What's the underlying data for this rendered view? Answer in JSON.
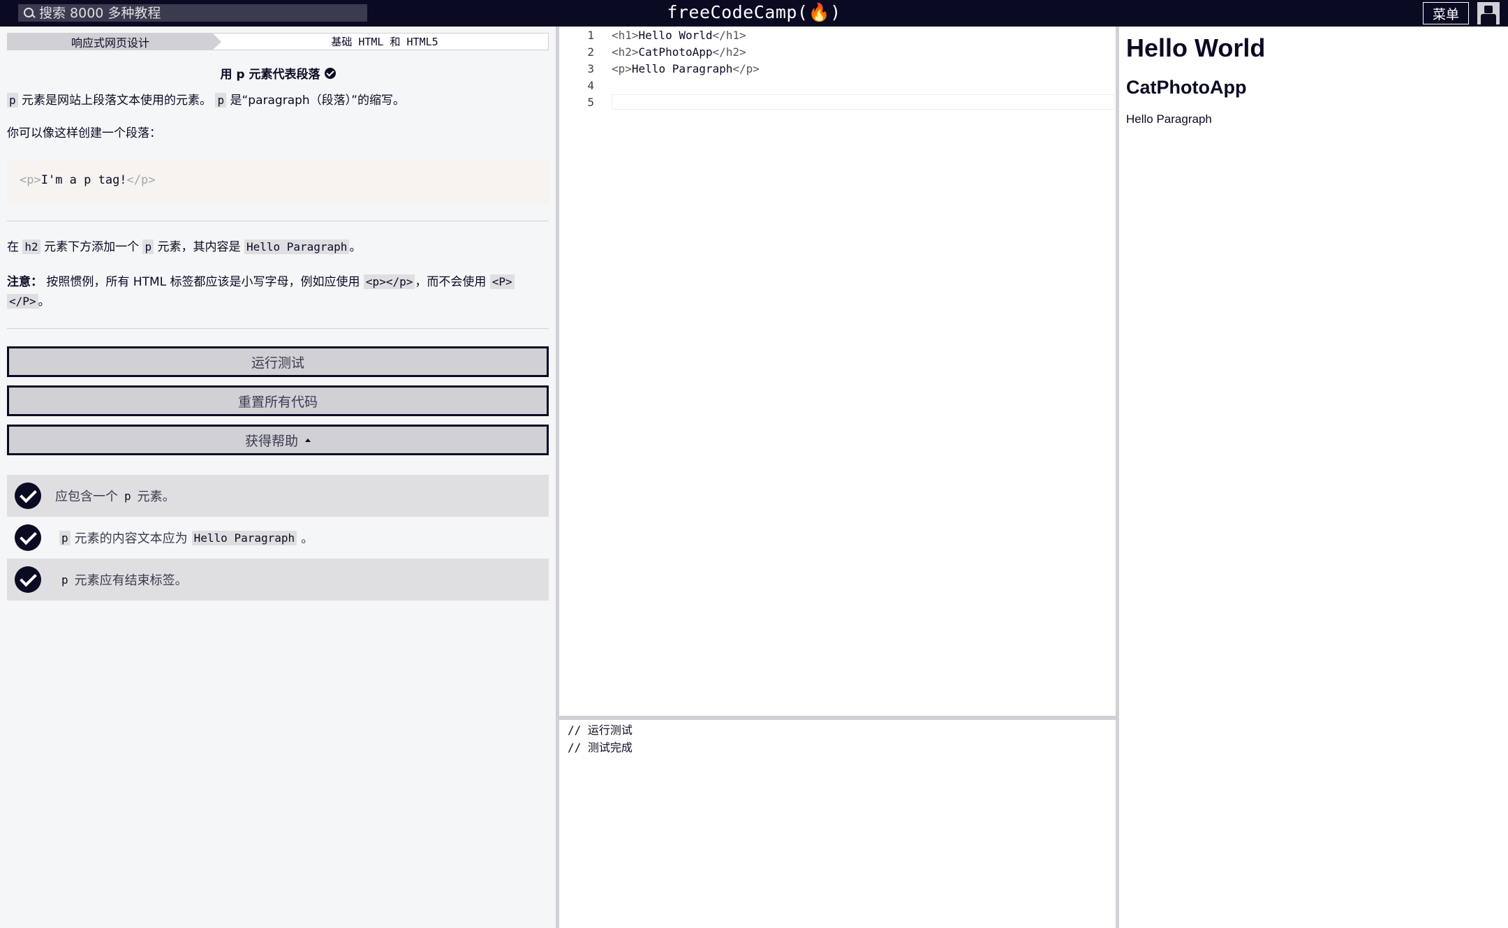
{
  "topbar": {
    "search_placeholder": "搜索 8000 多种教程",
    "brand": "freeCodeCamp(🔥)",
    "menu_label": "菜单"
  },
  "breadcrumb": {
    "superblock": "响应式网页设计",
    "block": "基础 HTML 和 HTML5"
  },
  "challenge": {
    "title": "用 p 元素代表段落",
    "desc1_code1": "p",
    "desc1_text1": " 元素是网站上段落文本使用的元素。 ",
    "desc1_code2": "p",
    "desc1_text2": " 是“paragraph（段落）”的缩写。",
    "desc2": "你可以像这样创建一个段落：",
    "example_open": "<p>",
    "example_text": "I'm a p tag!",
    "example_close": "</p>",
    "instr_text1": "在 ",
    "instr_code1": "h2",
    "instr_text2": " 元素下方添加一个 ",
    "instr_code2": "p",
    "instr_text3": " 元素，其内容是 ",
    "instr_code3": "Hello Paragraph",
    "instr_text4": "。",
    "note_label": "注意：",
    "note_text1": " 按照惯例，所有 HTML 标签都应该是小写字母，例如应使用 ",
    "note_code1": "<p></p>",
    "note_text2": "，而不会使用 ",
    "note_code2a": "<P>",
    "note_code2b": "</P>",
    "note_text3": "。"
  },
  "buttons": {
    "run": "运行测试",
    "reset": "重置所有代码",
    "help": "获得帮助"
  },
  "tests": [
    {
      "pre": "应包含一个",
      "code": "p",
      "post": "元素。"
    },
    {
      "pre": "",
      "code": "p",
      "post": "元素的内容文本应为",
      "code2": "Hello Paragraph",
      "post2": "。"
    },
    {
      "pre": "",
      "code": "p",
      "post": "元素应有结束标签。"
    }
  ],
  "editor": {
    "line_numbers": [
      "1",
      "2",
      "3",
      "4",
      "5"
    ],
    "lines": [
      {
        "open": "<h1>",
        "text": "Hello World",
        "close": "</h1>"
      },
      {
        "open": "<h2>",
        "text": "CatPhotoApp",
        "close": "</h2>"
      },
      {
        "open": "<p>",
        "text": "Hello Paragraph",
        "close": "</p>"
      }
    ]
  },
  "console": {
    "line1": "// 运行测试",
    "line2": "// 测试完成"
  },
  "preview": {
    "h1": "Hello World",
    "h2": "CatPhotoApp",
    "p": "Hello Paragraph"
  }
}
